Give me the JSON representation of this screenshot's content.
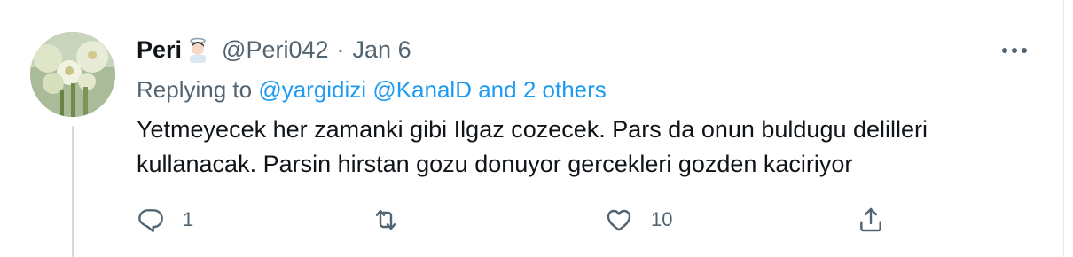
{
  "tweet": {
    "author": {
      "name": "Peri",
      "name_emoji": "angel-emoji",
      "handle": "@Peri042",
      "separator": "·",
      "date": "Jan 6"
    },
    "replying": {
      "prefix": "Replying to",
      "mentions": [
        "@yargidizi",
        "@KanalD"
      ],
      "others": "and 2 others"
    },
    "text_lines": [
      "Yetmeyecek her zamanki gibi Ilgaz cozecek. Pars da onun buldugu delilleri",
      "kullanacak. Parsin hirstan gozu donuyor gercekleri gozden kaciriyor"
    ],
    "actions": {
      "reply": {
        "icon": "reply-icon",
        "count": "1"
      },
      "retweet": {
        "icon": "retweet-icon",
        "count": ""
      },
      "like": {
        "icon": "heart-icon",
        "count": "10"
      },
      "share": {
        "icon": "share-icon"
      }
    },
    "more_icon": "more-horizontal-icon"
  },
  "colors": {
    "link": "#1d9bf0",
    "secondary_text": "#536471",
    "primary_text": "#0f1419",
    "thread_line": "#cfd9de"
  }
}
